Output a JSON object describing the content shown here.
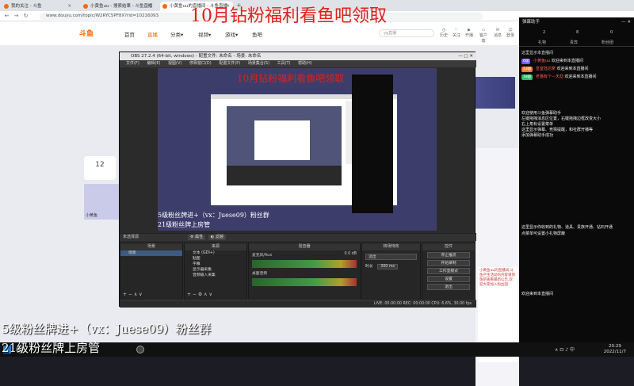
{
  "browser": {
    "tabs": [
      {
        "label": "我的关注 - 斗鱼",
        "color": "#f60"
      },
      {
        "label": "小黄鱼uu - 搜索结果 - 斗鱼直播",
        "color": "#f60"
      },
      {
        "label": "小黄鱼uu的直播间 - 斗鱼直播",
        "color": "#f60"
      }
    ],
    "url": "www.douyu.com/topic/W2RYC5PF8X?rid=10216093"
  },
  "douyu": {
    "logo": "斗鱼",
    "nav": [
      "首页",
      "直播",
      "分类▾",
      "视频▾",
      "游戏▾",
      "鱼吧"
    ],
    "search_placeholder": "yg直播",
    "header_icons": [
      "历史",
      "关注",
      "开播",
      "客户端",
      "消息",
      "登录"
    ],
    "left_card_number": "12",
    "room_name": "小黄鱼"
  },
  "obs": {
    "title": "OBS 27.2.4 (64-bit, windows) - 配置文件: 未命名 - 场景: 未命名",
    "menu": [
      "文件(F)",
      "编辑(E)",
      "视图(V)",
      "停靠窗口(D)",
      "配置文件(P)",
      "场景集合(S)",
      "工具(T)",
      "帮助(H)"
    ],
    "no_source": "未选择源",
    "properties_btn": "⚙ 属性",
    "filters_btn": "◐ 滤镜",
    "docks": {
      "scenes": {
        "title": "场景",
        "items": [
          "场景"
        ]
      },
      "sources": {
        "title": "来源",
        "items": [
          "文本 (GDI+)",
          "贴图",
          "字幕",
          "显示器采集",
          "音频输入采集"
        ]
      },
      "mixer": {
        "title": "混音器",
        "tracks": [
          "麦克风/Aux",
          "桌面音频"
        ],
        "db": "0.0 dB"
      },
      "transitions": {
        "title": "转场特效",
        "selected": "淡出",
        "duration_label": "时长",
        "duration": "300 ms"
      },
      "controls": {
        "title": "控件",
        "buttons": [
          "停止推流",
          "开始录制",
          "工作室模式",
          "设置",
          "退出"
        ]
      }
    },
    "status": "LIVE: 00:00:00    REC: 00:00:00    CPU: 6.6%, 30.00 fps"
  },
  "panel": {
    "title": "弹幕助手",
    "stats": [
      "2",
      "8",
      "0"
    ],
    "tabs": [
      "礼物",
      "贵宾",
      "粉丝团"
    ],
    "entries": [
      {
        "badge": "6级",
        "badge_color": "#7b5cff",
        "name": "小黄鱼uu",
        "text": "欢迎来到本直播间"
      },
      {
        "badge": "13级",
        "badge_color": "#ff7a2b",
        "name": "皇室陆达摩",
        "text": "欢迎来到本直播间"
      },
      {
        "badge": "18级",
        "badge_color": "#2bbf6a",
        "name": "老猫有个—天劫",
        "text": "欢迎来到本直播间"
      }
    ],
    "tips": [
      "欢迎使用斗鱼弹幕助手",
      "左键拖拽消息区位置，右键拖拽边框改变大小",
      "右上角有设置菜单",
      "这里显示弹幕、竞猜提醒，和社群开播等",
      "添加弹幕助手成功"
    ],
    "tips2": [
      "这里显示你收到的礼物、道具、贵族开通、钻石开通",
      "点菜单可设置小礼物屏蔽"
    ],
    "bottom": "欢迎来到本直播间"
  },
  "captions": {
    "top": "10月钻粉福利看鱼吧领取",
    "obs_top": "10月钻粉福利看鱼吧领取",
    "bottom": "5级粉丝牌进+（vx：Juese09）粉丝群",
    "bottom2": "21级粉丝牌上房管",
    "obs_bottom": "5级粉丝牌进+（vx：Juese09）粉丝群",
    "obs_bottom2": "21级粉丝牌上房管"
  },
  "taskbar": {
    "time": "20:29",
    "date": "2022/11/7"
  },
  "chat_snippet": "小黄鱼uu的直播间,斗鱼产生活动的内容请到鱼吧查看最新公告,欢迎大家加入粉丝团"
}
